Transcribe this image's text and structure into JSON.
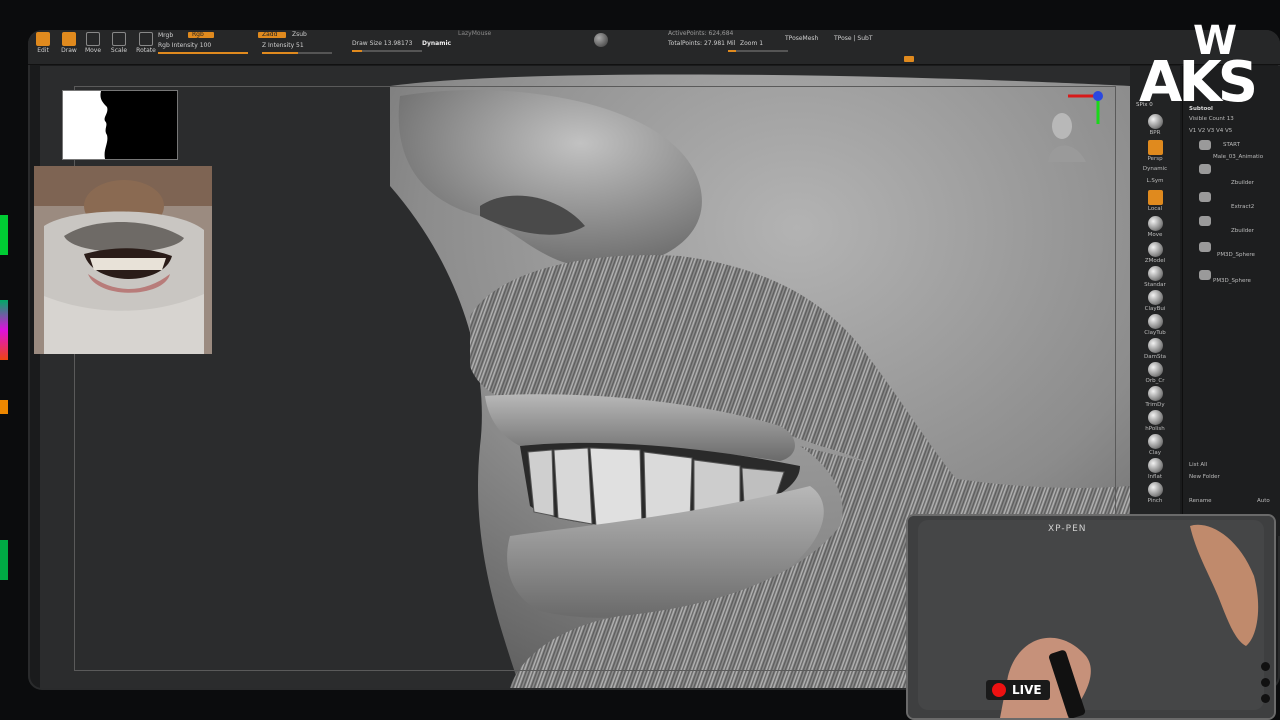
{
  "toolbar": {
    "buttons": [
      {
        "label": "Edit",
        "active": true
      },
      {
        "label": "Draw",
        "active": true
      },
      {
        "label": "Move",
        "active": false
      },
      {
        "label": "Scale",
        "active": false
      },
      {
        "label": "Rotate",
        "active": false
      }
    ],
    "mrgb_label": "Mrgb",
    "rgb_label": "Rgb",
    "rgb_intensity": "Rgb Intensity 100",
    "zadd_label": "Zadd",
    "zsub_label": "Zsub",
    "z_intensity": "Z Intensity 51",
    "draw_size": "Draw Size 13.98173",
    "dynamic_label": "Dynamic",
    "lazymouse_label": "LazyMouse",
    "active_points": "ActivePoints: 624,684",
    "total_points": "TotalPoints: 27.981 Mil",
    "zoom_label": "Zoom 1",
    "tpose_mesh": "TPoseMesh",
    "tpose_subt": "TPose | SubT"
  },
  "brush_shelf": {
    "spix": "SPix 0",
    "items": [
      {
        "label": "BPR",
        "kind": "ball"
      },
      {
        "label": "Persp",
        "kind": "orange"
      },
      {
        "label": "Dynamic",
        "kind": "text"
      },
      {
        "label": "L.Sym",
        "kind": "text"
      },
      {
        "label": "Local",
        "kind": "orange"
      },
      {
        "label": "Move",
        "kind": "ball"
      },
      {
        "label": "ZModel",
        "kind": "ball"
      },
      {
        "label": "Standar",
        "kind": "ball"
      },
      {
        "label": "ClayBui",
        "kind": "ball"
      },
      {
        "label": "ClayTub",
        "kind": "ball"
      },
      {
        "label": "DamSta",
        "kind": "ball"
      },
      {
        "label": "Orb_Cr",
        "kind": "ball"
      },
      {
        "label": "TrimDy",
        "kind": "ball"
      },
      {
        "label": "hPolish",
        "kind": "ball"
      },
      {
        "label": "Clay",
        "kind": "ball"
      },
      {
        "label": "Inflat",
        "kind": "ball"
      },
      {
        "label": "Pinch",
        "kind": "ball"
      }
    ]
  },
  "subtool": {
    "title": "Subtool",
    "visible_count": "Visible Count 13",
    "versions": "V1 V2 V3 V4 V5",
    "items": [
      "START",
      "Male_03_Animatio",
      "Zbuilder",
      "Extract2",
      "Zbuilder",
      "PM3D_Sphere",
      "PM3D_Sphere"
    ],
    "list_all": "List All",
    "new_folder": "New Folder",
    "rename": "Rename",
    "auto": "Auto"
  },
  "logo": {
    "top": "W",
    "bottom": "AKS"
  },
  "webcam": {
    "tablet_brand": "XP-PEN",
    "live_label": "LIVE"
  },
  "colors": {
    "accent": "#e08a1e",
    "sculpt_gray": "#9a9a9a",
    "live_red": "#e11111"
  }
}
